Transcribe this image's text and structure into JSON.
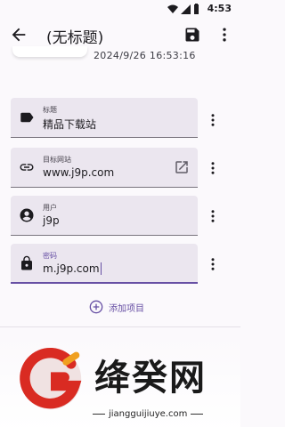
{
  "status_bar": {
    "time": "4:53"
  },
  "app_bar": {
    "title": "(无标题)"
  },
  "entry": {
    "datetime": "2024/9/26 16:53:16",
    "fields": [
      {
        "label": "标题",
        "value": "精品下载站",
        "icon": "label-tag-icon"
      },
      {
        "label": "目标网站",
        "value": "www.j9p.com",
        "icon": "link-icon",
        "trailing_icon": "open-external-icon"
      },
      {
        "label": "用户",
        "value": "j9p",
        "icon": "account-circle-icon"
      },
      {
        "label": "密码",
        "value": "m.j9p.com",
        "icon": "lock-icon"
      }
    ],
    "add_item_label": "添加项目"
  },
  "watermark": {
    "brand": "绛癸网",
    "url": "jiangguijiuye.com"
  },
  "colors": {
    "accent": "#6750a4",
    "field_bg": "#ebe6ef",
    "background": "#fbf9fc"
  }
}
